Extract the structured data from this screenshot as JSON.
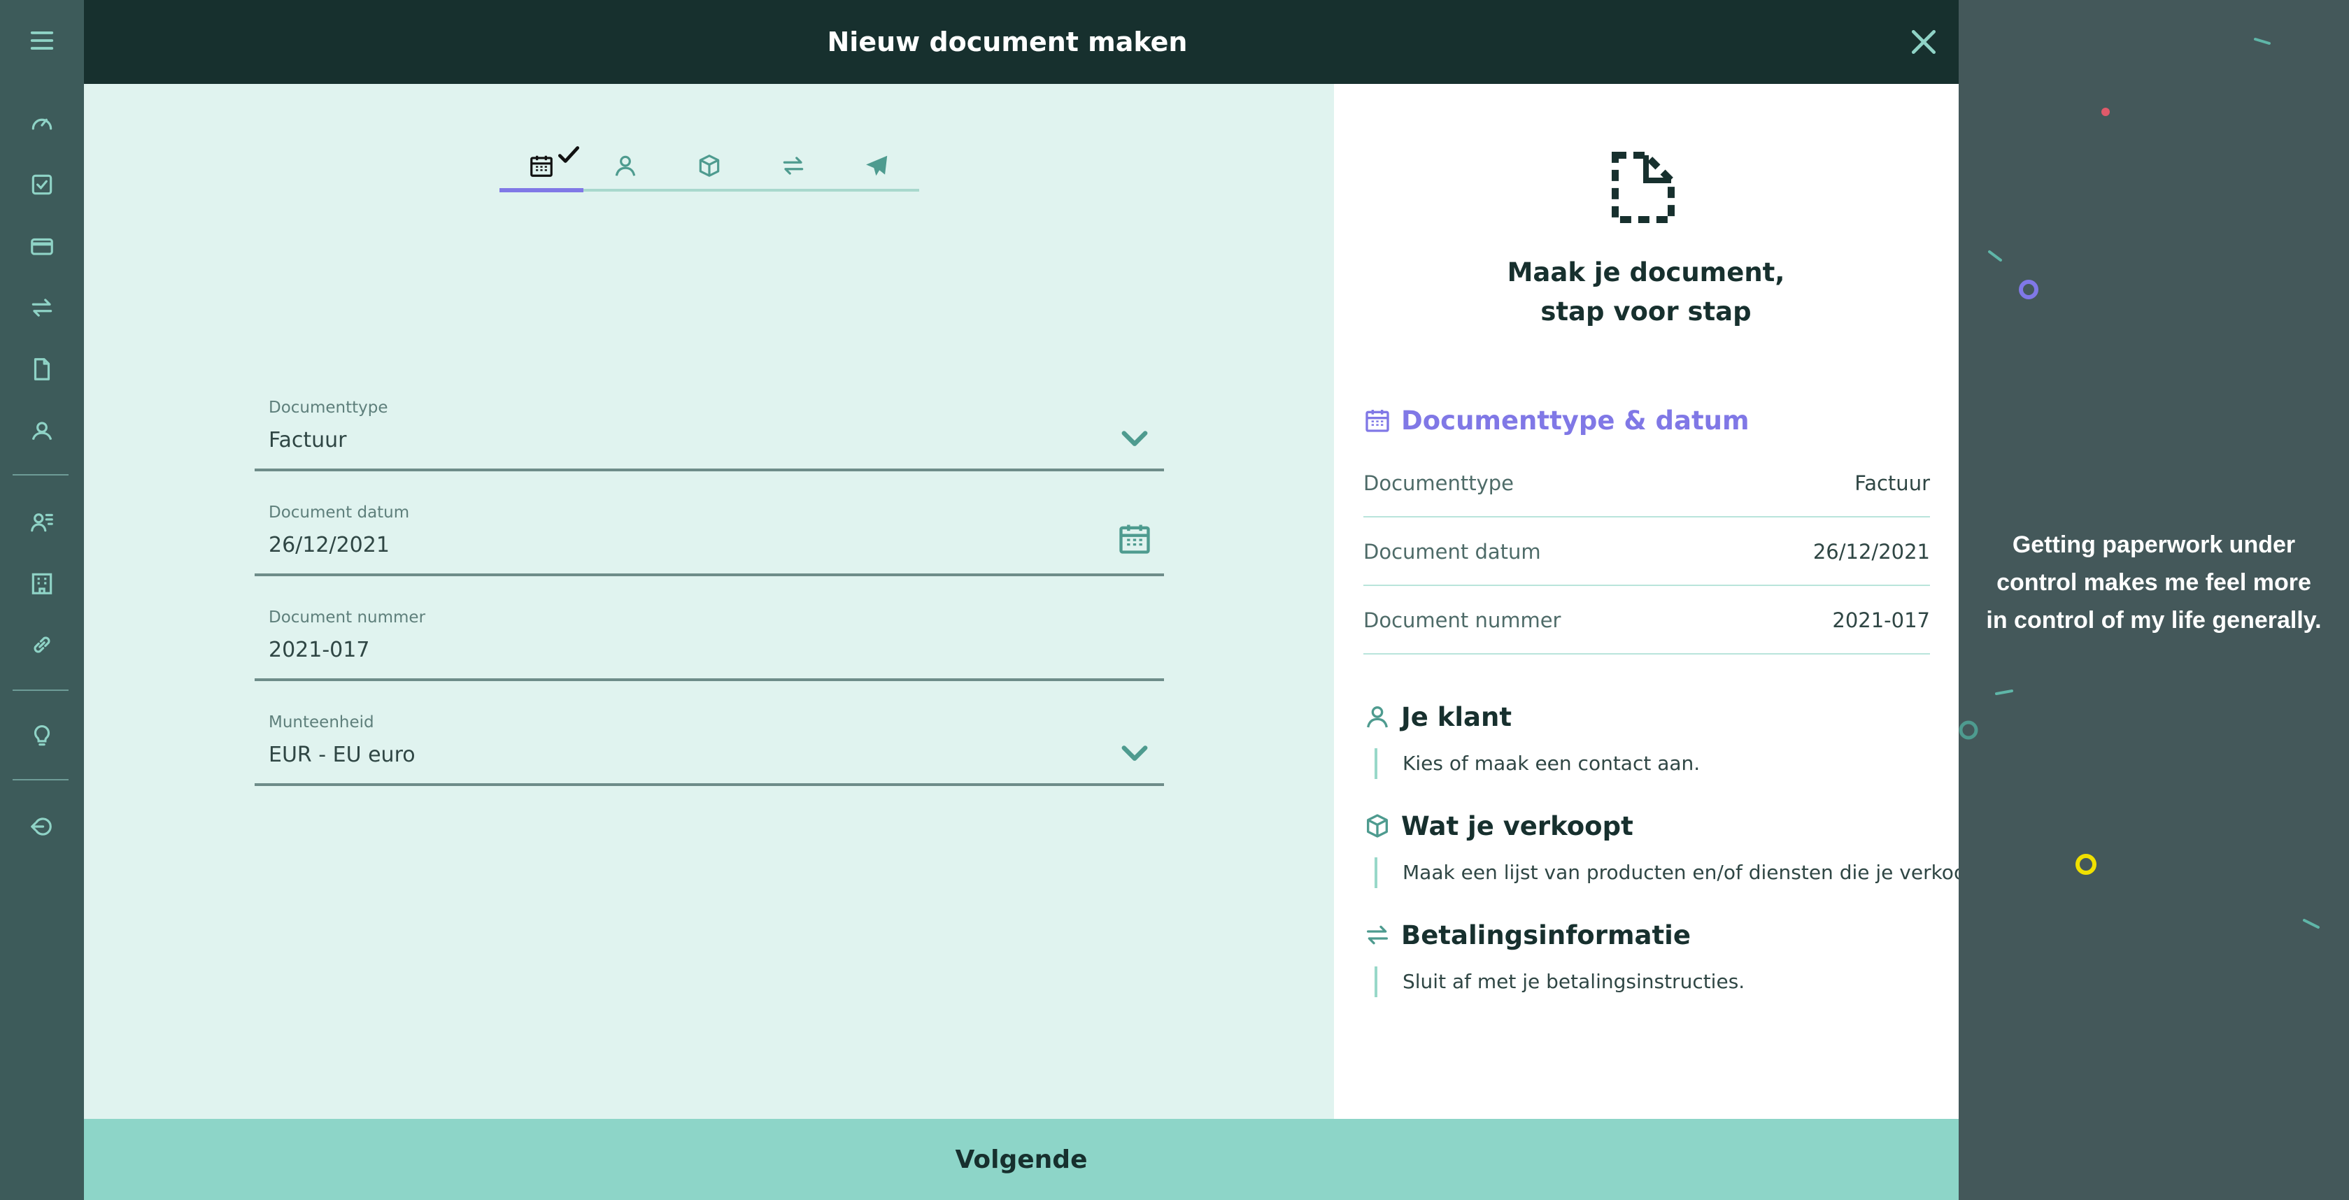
{
  "sidebar": {
    "items": [
      {
        "icon": "gauge-icon"
      },
      {
        "icon": "checkbox-icon"
      },
      {
        "icon": "card-icon"
      },
      {
        "icon": "transfer-icon"
      },
      {
        "icon": "document-icon"
      },
      {
        "icon": "user-icon"
      },
      {
        "icon": "contacts-icon"
      },
      {
        "icon": "building-icon"
      },
      {
        "icon": "link-icon"
      },
      {
        "icon": "lightbulb-icon"
      },
      {
        "icon": "logout-icon"
      }
    ]
  },
  "modal": {
    "title": "Nieuw document maken",
    "next_label": "Volgende"
  },
  "steps": {
    "active_index": 0,
    "items": [
      {
        "icon": "calendar-icon",
        "completed": true
      },
      {
        "icon": "user-icon",
        "completed": false
      },
      {
        "icon": "box-icon",
        "completed": false
      },
      {
        "icon": "transfer-icon",
        "completed": false
      },
      {
        "icon": "send-icon",
        "completed": false
      }
    ]
  },
  "form": {
    "document_type": {
      "label": "Documenttype",
      "value": "Factuur"
    },
    "document_date": {
      "label": "Document datum",
      "value": "26/12/2021"
    },
    "document_number": {
      "label": "Document nummer",
      "value": "2021-017"
    },
    "currency": {
      "label": "Munteenheid",
      "value": "EUR - EU euro"
    }
  },
  "summary": {
    "title": "Maak je document, stap voor stap",
    "section_type_date": {
      "title": "Documenttype & datum",
      "rows": [
        {
          "key": "Documenttype",
          "value": "Factuur"
        },
        {
          "key": "Document datum",
          "value": "26/12/2021"
        },
        {
          "key": "Document nummer",
          "value": "2021-017"
        }
      ]
    },
    "client": {
      "title": "Je klant",
      "desc": "Kies of maak een contact aan."
    },
    "items": {
      "title": "Wat je verkoopt",
      "desc": "Maak een lijst van producten en/of diensten die je verkoopt."
    },
    "payment": {
      "title": "Betalingsinformatie",
      "desc": "Sluit af met je betalingsinstructies."
    }
  },
  "quote": {
    "text": "Getting paperwork under control makes me feel more in control of my life generally."
  },
  "colors": {
    "accent": "#8078e6",
    "header_bg": "#17302e",
    "rail_bg": "#3d5b5a",
    "icon_teal": "#4e9b8f",
    "form_bg": "#e0f3ef",
    "next_button_bg": "#8dd5c8"
  }
}
